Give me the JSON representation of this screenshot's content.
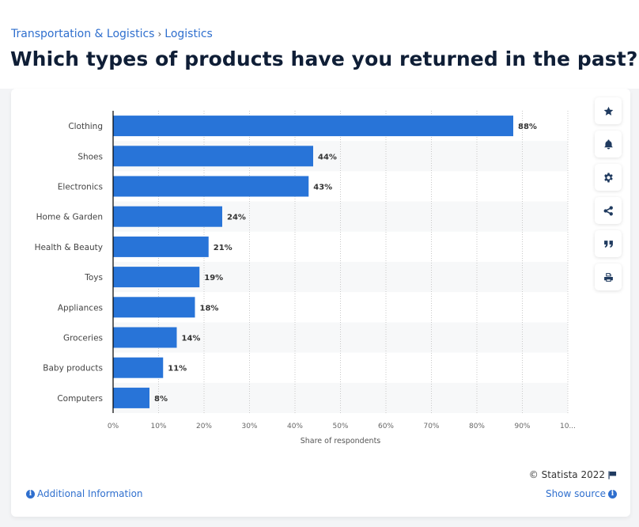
{
  "breadcrumb": {
    "items": [
      "Transportation & Logistics",
      "Logistics"
    ],
    "separator": "›"
  },
  "page": {
    "title": "Which types of products have you returned in the past?"
  },
  "toolbar": {
    "icons": [
      "star-icon",
      "bell-icon",
      "gear-icon",
      "share-icon",
      "quote-icon",
      "print-icon"
    ]
  },
  "footer": {
    "copyright": "© Statista 2022",
    "additional_info": "Additional Information",
    "show_source": "Show source"
  },
  "colors": {
    "bar": "#2874d8",
    "link": "#2f6fce",
    "title": "#0f1e36"
  },
  "chart_data": {
    "type": "bar",
    "orientation": "horizontal",
    "title": "Which types of products have you returned in the past?",
    "categories": [
      "Clothing",
      "Shoes",
      "Electronics",
      "Home & Garden",
      "Health & Beauty",
      "Toys",
      "Appliances",
      "Groceries",
      "Baby products",
      "Computers"
    ],
    "values": [
      88,
      44,
      43,
      24,
      21,
      19,
      18,
      14,
      11,
      8
    ],
    "value_labels": [
      "88%",
      "44%",
      "43%",
      "24%",
      "21%",
      "19%",
      "18%",
      "14%",
      "11%",
      "8%"
    ],
    "xlabel": "Share of respondents",
    "ylabel": "",
    "xlim": [
      0,
      100
    ],
    "x_ticks": [
      "0%",
      "10%",
      "20%",
      "30%",
      "40%",
      "50%",
      "60%",
      "70%",
      "80%",
      "90%",
      "10..."
    ],
    "grid": true,
    "legend": "none"
  }
}
